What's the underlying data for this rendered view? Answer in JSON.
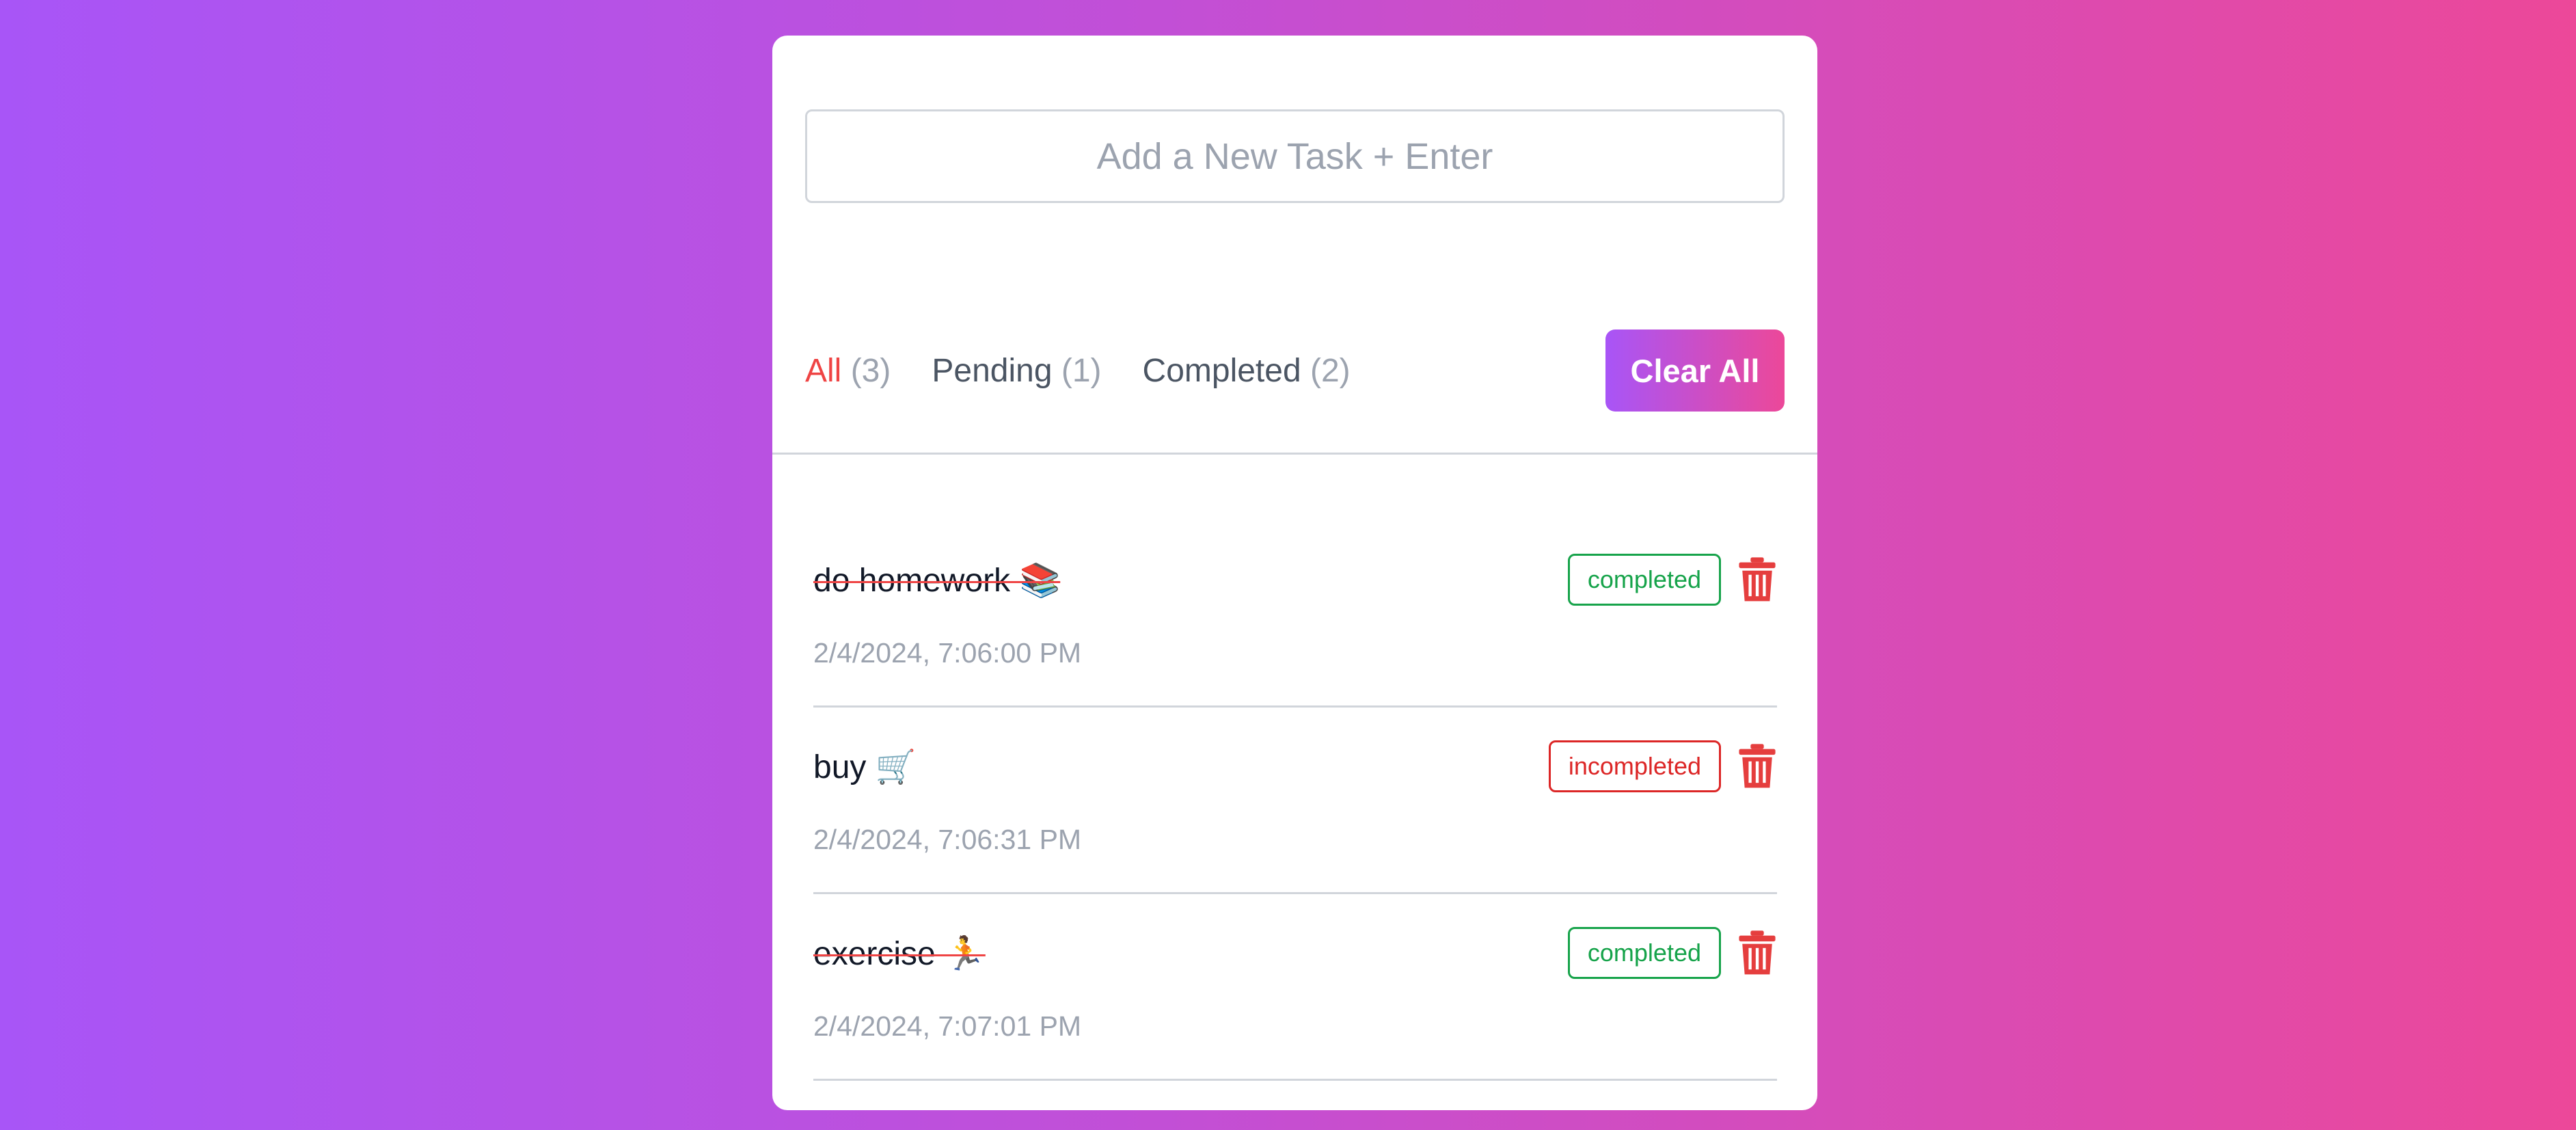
{
  "input": {
    "placeholder": "Add a New Task + Enter"
  },
  "filters": [
    {
      "label": "All",
      "count": "(3)",
      "active": true
    },
    {
      "label": "Pending",
      "count": "(1)",
      "active": false
    },
    {
      "label": "Completed",
      "count": "(2)",
      "active": false
    }
  ],
  "clear_button": {
    "label": "Clear All"
  },
  "tasks": [
    {
      "name": "do homework 📚",
      "date": "2/4/2024, 7:06:00 PM",
      "status": "completed",
      "done": true
    },
    {
      "name": "buy 🛒",
      "date": "2/4/2024, 7:06:31 PM",
      "status": "incompleted",
      "done": false
    },
    {
      "name": "exercise 🏃",
      "date": "2/4/2024, 7:07:01 PM",
      "status": "completed",
      "done": true
    }
  ],
  "colors": {
    "gradient_start": "#a855f7",
    "gradient_end": "#ec4899",
    "active_filter": "#ef4444",
    "completed": "#16a34a",
    "incompleted": "#dc2626",
    "trash": "#e53e3e"
  },
  "icons": {
    "delete": "trash-icon"
  }
}
